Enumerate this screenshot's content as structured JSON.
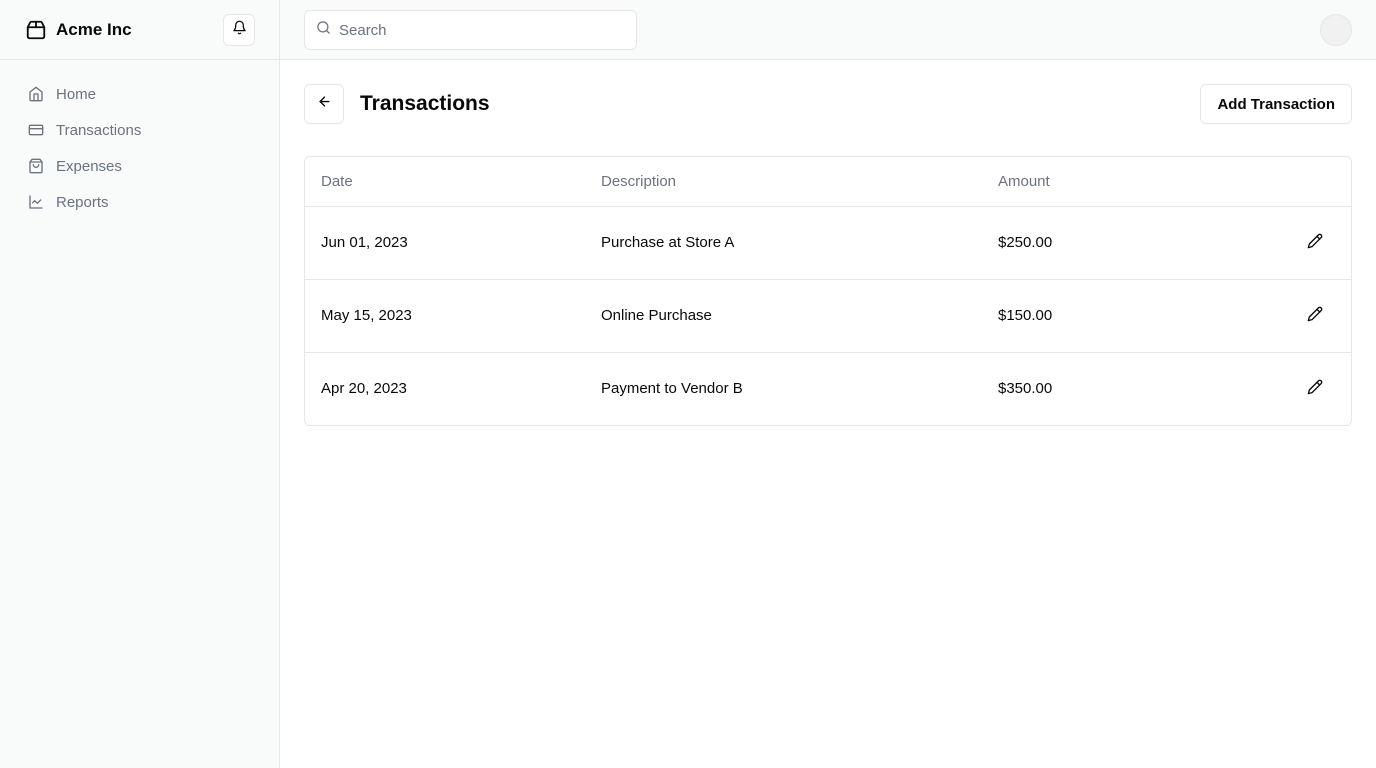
{
  "brand": {
    "name": "Acme Inc",
    "icon": "package-icon"
  },
  "sidebar": {
    "items": [
      {
        "label": "Home",
        "icon": "home-icon"
      },
      {
        "label": "Transactions",
        "icon": "credit-card-icon"
      },
      {
        "label": "Expenses",
        "icon": "shopping-bag-icon"
      },
      {
        "label": "Reports",
        "icon": "line-chart-icon"
      }
    ]
  },
  "search": {
    "placeholder": "Search",
    "value": ""
  },
  "page": {
    "title": "Transactions",
    "add_label": "Add Transaction"
  },
  "table": {
    "headers": {
      "date": "Date",
      "description": "Description",
      "amount": "Amount"
    },
    "rows": [
      {
        "date": "Jun 01, 2023",
        "description": "Purchase at Store A",
        "amount": "$250.00"
      },
      {
        "date": "May 15, 2023",
        "description": "Online Purchase",
        "amount": "$150.00"
      },
      {
        "date": "Apr 20, 2023",
        "description": "Payment to Vendor B",
        "amount": "$350.00"
      }
    ]
  },
  "colors": {
    "border": "#e5e7eb",
    "muted_text": "#6b7280",
    "sidebar_bg": "#f9fafa",
    "text": "#09090b"
  }
}
